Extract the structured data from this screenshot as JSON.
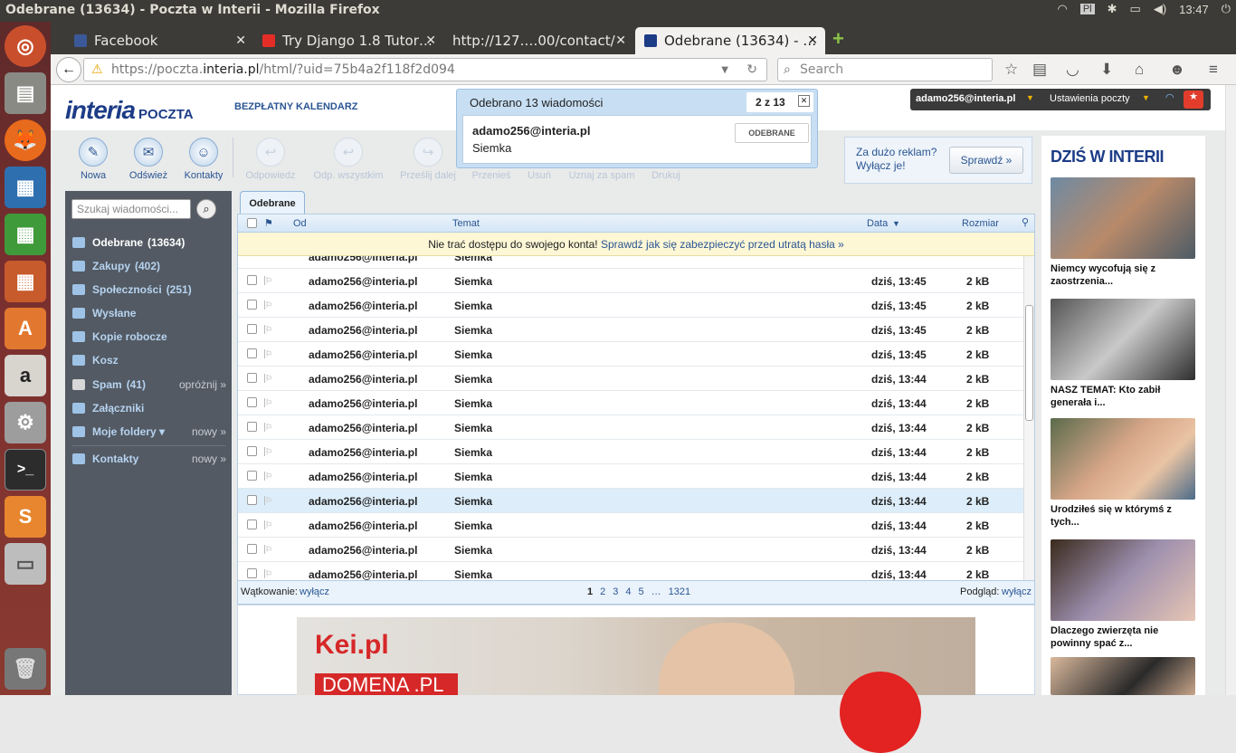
{
  "window": {
    "title": "Odebrane (13634) - Poczta w Interii - Mozilla Firefox",
    "clock": "13:47"
  },
  "tabs": [
    {
      "label": "Facebook"
    },
    {
      "label": "Try Django 1.8 Tutor…"
    },
    {
      "label": "http://127.…00/contact/"
    },
    {
      "label": "Odebrane (13634) - …"
    }
  ],
  "nav": {
    "url_prefix": "https://poczta.",
    "url_domain": "interia.pl",
    "url_rest": "/html/?uid=75b4a2f118f2d094",
    "search_placeholder": "Search"
  },
  "header": {
    "logo": "interia",
    "logo_sub": "POCZTA",
    "calendar_link": "BEZPŁATNY KALENDARZ",
    "user": "adamo256@interia.pl",
    "settings": "Ustawienia poczty"
  },
  "notification": {
    "title": "Odebrano 13 wiadomości",
    "counter": "2 z 13",
    "sender": "adamo256@interia.pl",
    "subject": "Siemka",
    "folder_button": "ODEBRANE"
  },
  "toolbar": {
    "buttons": [
      "Nowa",
      "Odśwież",
      "Kontakty"
    ],
    "disabled": [
      "Odpowiedz",
      "Odp. wszystkim",
      "Prześlij dalej",
      "Przenieś",
      "Usuń",
      "Uznaj za spam",
      "Drukuj"
    ]
  },
  "adbox": {
    "text1": "Za dużo reklam?",
    "text2": "Wyłącz je!",
    "button": "Sprawdź »"
  },
  "sidebar": {
    "search_placeholder": "Szukaj wiadomości...",
    "folders": [
      {
        "label": "Odebrane",
        "count": "(13634)"
      },
      {
        "label": "Zakupy",
        "count": "(402)"
      },
      {
        "label": "Społeczności",
        "count": "(251)"
      },
      {
        "label": "Wysłane",
        "count": ""
      },
      {
        "label": "Kopie robocze",
        "count": ""
      },
      {
        "label": "Kosz",
        "count": ""
      },
      {
        "label": "Spam",
        "count": "(41)",
        "action": "opróżnij »"
      },
      {
        "label": "Załączniki",
        "count": ""
      },
      {
        "label": "Moje foldery ▾",
        "count": "",
        "action": "nowy »"
      },
      {
        "label": "Kontakty",
        "count": "",
        "action": "nowy »"
      }
    ]
  },
  "mail": {
    "tab": "Odebrane",
    "columns": {
      "from": "Od",
      "subject": "Temat",
      "date": "Data",
      "size": "Rozmiar"
    },
    "warning_text": "Nie trać dostępu do swojego konta!",
    "warning_link": "Sprawdź jak się zabezpieczyć przed utratą hasła »",
    "rows": [
      {
        "from": "adamo256@interia.pl",
        "subject": "Siemka",
        "date": "dziś, 13:45",
        "size": "2 kB"
      },
      {
        "from": "adamo256@interia.pl",
        "subject": "Siemka",
        "date": "dziś, 13:45",
        "size": "2 kB"
      },
      {
        "from": "adamo256@interia.pl",
        "subject": "Siemka",
        "date": "dziś, 13:45",
        "size": "2 kB"
      },
      {
        "from": "adamo256@interia.pl",
        "subject": "Siemka",
        "date": "dziś, 13:45",
        "size": "2 kB"
      },
      {
        "from": "adamo256@interia.pl",
        "subject": "Siemka",
        "date": "dziś, 13:44",
        "size": "2 kB"
      },
      {
        "from": "adamo256@interia.pl",
        "subject": "Siemka",
        "date": "dziś, 13:44",
        "size": "2 kB"
      },
      {
        "from": "adamo256@interia.pl",
        "subject": "Siemka",
        "date": "dziś, 13:44",
        "size": "2 kB"
      },
      {
        "from": "adamo256@interia.pl",
        "subject": "Siemka",
        "date": "dziś, 13:44",
        "size": "2 kB"
      },
      {
        "from": "adamo256@interia.pl",
        "subject": "Siemka",
        "date": "dziś, 13:44",
        "size": "2 kB"
      },
      {
        "from": "adamo256@interia.pl",
        "subject": "Siemka",
        "date": "dziś, 13:44",
        "size": "2 kB"
      },
      {
        "from": "adamo256@interia.pl",
        "subject": "Siemka",
        "date": "dziś, 13:44",
        "size": "2 kB"
      },
      {
        "from": "adamo256@interia.pl",
        "subject": "Siemka",
        "date": "dziś, 13:44",
        "size": "2 kB"
      },
      {
        "from": "adamo256@interia.pl",
        "subject": "Siemka",
        "date": "dziś, 13:44",
        "size": "2 kB"
      }
    ],
    "footer": {
      "threading_label": "Wątkowanie:",
      "threading_link": "wyłącz",
      "pages": [
        "1",
        "2",
        "3",
        "4",
        "5",
        "…",
        "1321"
      ],
      "preview_label": "Podgląd:",
      "preview_link": "wyłącz"
    }
  },
  "ad": {
    "brand": "Kei.pl",
    "banner": "DOMENA .PL"
  },
  "right": {
    "heading": "DZIŚ W INTERII",
    "news": [
      {
        "caption": "Niemcy wycofują się z zaostrzenia..."
      },
      {
        "caption": "NASZ TEMAT: Kto zabił generała i..."
      },
      {
        "caption": "Urodziłeś się w którymś z tych..."
      },
      {
        "caption": "Dlaczego zwierzęta nie powinny spać z..."
      }
    ]
  }
}
